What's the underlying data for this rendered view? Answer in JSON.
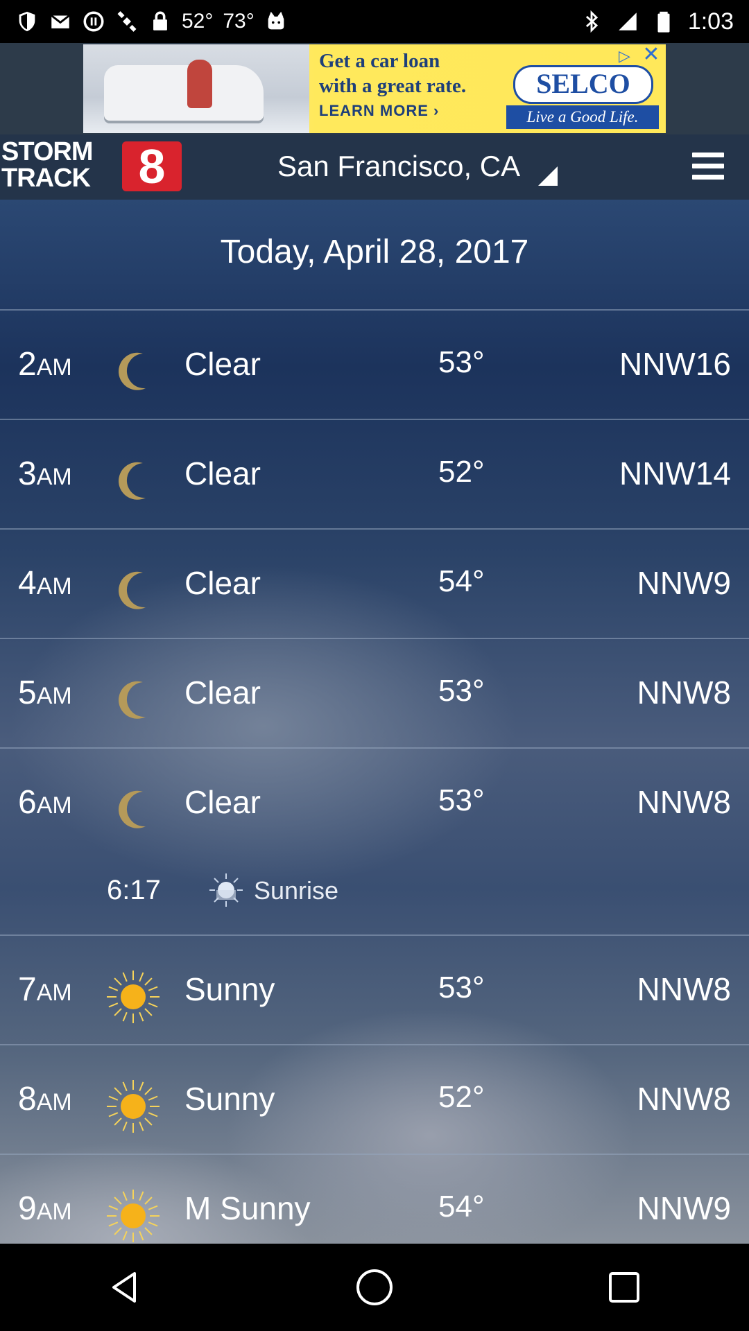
{
  "status_bar": {
    "temp_current": "52°",
    "temp_high": "73°",
    "time": "1:03"
  },
  "ad": {
    "line1": "Get a car loan",
    "line2": "with a great rate.",
    "line3": "LEARN MORE ›",
    "logo": "SELCO",
    "tagline": "Live a Good Life."
  },
  "header": {
    "brand_line1": "STORM",
    "brand_line2": "TRACK",
    "brand_number": "8",
    "location": "San Francisco, CA"
  },
  "forecast": {
    "date_title": "Today, April 28, 2017",
    "rows": [
      {
        "hour": "2",
        "ampm": "AM",
        "icon": "moon-icon",
        "condition": "Clear",
        "temp": "53°",
        "wind": "NNW16"
      },
      {
        "hour": "3",
        "ampm": "AM",
        "icon": "moon-icon",
        "condition": "Clear",
        "temp": "52°",
        "wind": "NNW14"
      },
      {
        "hour": "4",
        "ampm": "AM",
        "icon": "moon-icon",
        "condition": "Clear",
        "temp": "54°",
        "wind": "NNW9"
      },
      {
        "hour": "5",
        "ampm": "AM",
        "icon": "moon-icon",
        "condition": "Clear",
        "temp": "53°",
        "wind": "NNW8"
      },
      {
        "hour": "6",
        "ampm": "AM",
        "icon": "moon-icon",
        "condition": "Clear",
        "temp": "53°",
        "wind": "NNW8"
      },
      {
        "hour": "7",
        "ampm": "AM",
        "icon": "sun-icon",
        "condition": "Sunny",
        "temp": "53°",
        "wind": "NNW8"
      },
      {
        "hour": "8",
        "ampm": "AM",
        "icon": "sun-icon",
        "condition": "Sunny",
        "temp": "52°",
        "wind": "NNW8"
      },
      {
        "hour": "9",
        "ampm": "AM",
        "icon": "sun-icon",
        "condition": "M Sunny",
        "temp": "54°",
        "wind": "NNW9"
      }
    ],
    "sunrise": {
      "time": "6:17",
      "label": "Sunrise"
    }
  },
  "colors": {
    "header_bg": "#24344a",
    "brand_red": "#d9232d",
    "moon": "#b59a5a",
    "sun": "#f6b21a"
  }
}
